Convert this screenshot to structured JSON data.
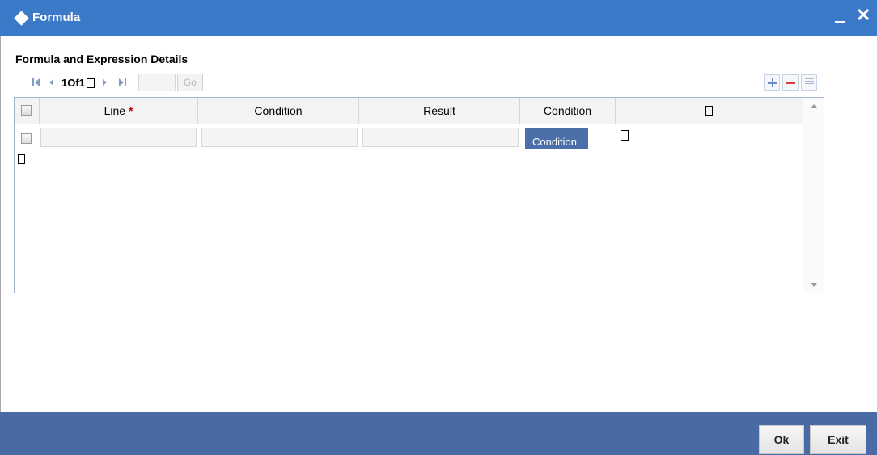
{
  "window": {
    "title": "Formula"
  },
  "section": {
    "title": "Formula and Expression Details"
  },
  "navigation": {
    "page_text": "1Of1",
    "go_label": "Go"
  },
  "table": {
    "headers": {
      "line": "Line",
      "required_mark": "*",
      "condition": "Condition",
      "result": "Result",
      "condition_action": "Condition"
    },
    "rows": [
      {
        "button_label": "Condition"
      }
    ]
  },
  "footer": {
    "ok_label": "Ok",
    "exit_label": "Exit"
  },
  "colors": {
    "titlebar": "#3b79c9",
    "footer": "#4a6aa5",
    "button_blue": "#4b6fa8",
    "required": "#c00000"
  }
}
